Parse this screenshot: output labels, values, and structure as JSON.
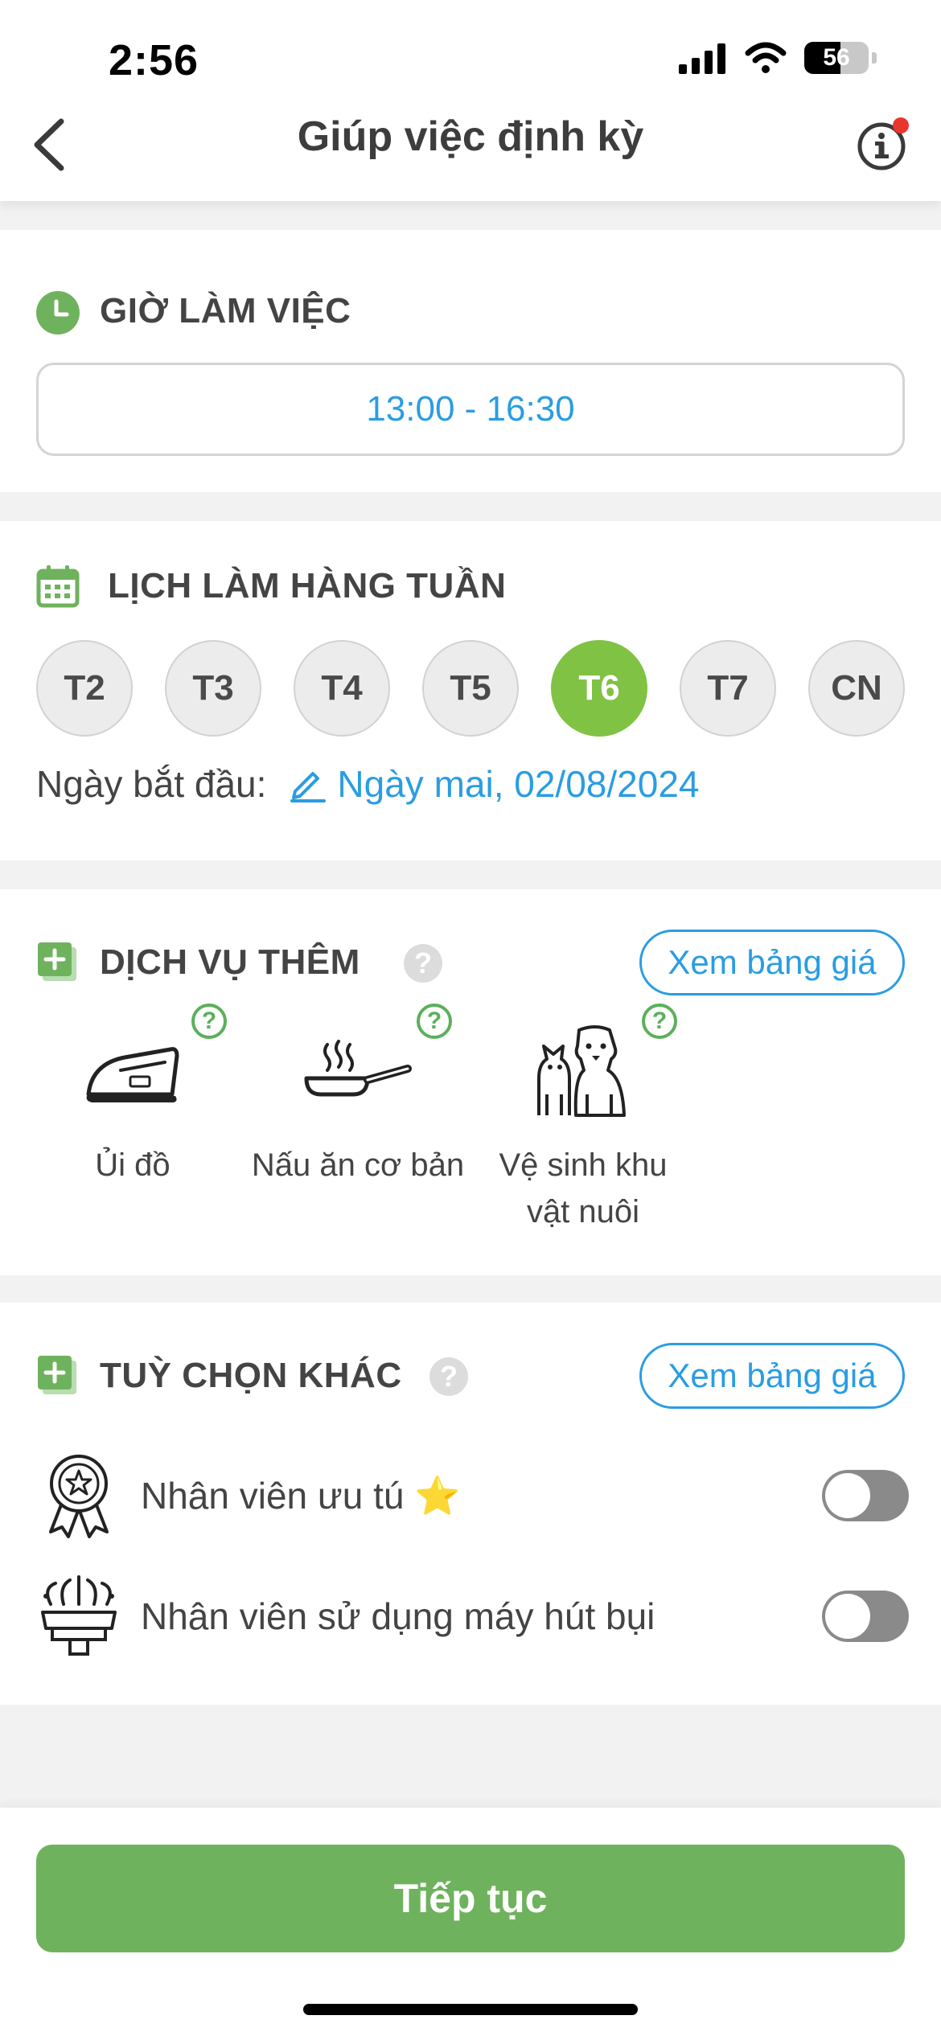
{
  "status": {
    "time": "2:56",
    "battery": "56"
  },
  "nav": {
    "title": "Giúp việc định kỳ"
  },
  "work_hours": {
    "title": "GIỜ LÀM VIỆC",
    "value": "13:00 - 16:30"
  },
  "weekly": {
    "title": "LỊCH LÀM HÀNG TUẦN",
    "days": [
      "T2",
      "T3",
      "T4",
      "T5",
      "T6",
      "T7",
      "CN"
    ],
    "selected_day": "T6",
    "start_label": "Ngày bắt đầu:",
    "start_value": "Ngày mai, 02/08/2024"
  },
  "extra_services": {
    "title": "DỊCH VỤ THÊM",
    "price_button": "Xem bảng giá",
    "items": [
      {
        "label": "Ủi đồ",
        "icon": "iron-icon"
      },
      {
        "label": "Nấu ăn cơ bản",
        "icon": "frying-pan-icon"
      },
      {
        "label": "Vệ sinh khu vật nuôi",
        "icon": "pets-icon"
      }
    ]
  },
  "other_options": {
    "title": "TUỲ CHỌN KHÁC",
    "price_button": "Xem bảng giá",
    "items": [
      {
        "label": "Nhân viên ưu tú ⭐",
        "icon": "award-badge-icon",
        "enabled": false
      },
      {
        "label": "Nhân viên sử dụng máy hút bụi",
        "icon": "vacuum-icon",
        "enabled": false
      }
    ]
  },
  "footer": {
    "continue_label": "Tiếp tục"
  },
  "colors": {
    "accent_green": "#80c244",
    "button_green": "#6fb25d",
    "link_blue": "#2a9de2"
  }
}
